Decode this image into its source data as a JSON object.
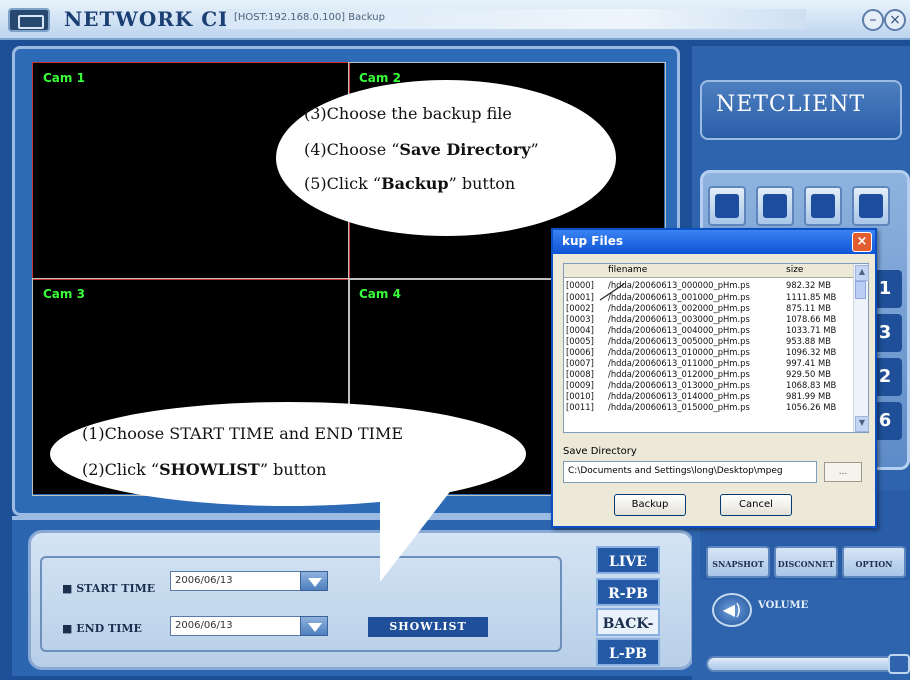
{
  "window": {
    "app_title": "NETWORK CLIENT",
    "host_info": "[HOST:192.168.0.100] Backup"
  },
  "cameras": [
    {
      "label": "Cam 1"
    },
    {
      "label": "Cam 2"
    },
    {
      "label": "Cam 3"
    },
    {
      "label": "Cam 4"
    }
  ],
  "controls": {
    "start_time_label": "START TIME",
    "start_time_value": "2006/06/13",
    "end_time_label": "END TIME",
    "end_time_value": "2006/06/13",
    "showlist_label": "SHOWLIST",
    "mode_buttons": [
      {
        "label": "LIVE"
      },
      {
        "label": "R-PB"
      },
      {
        "label": "BACK-UP"
      },
      {
        "label": "L-PB"
      }
    ]
  },
  "right_panel": {
    "brand": "NETCLIENT",
    "channel_numbers": [
      "1",
      "3",
      "2",
      "6"
    ],
    "func_buttons": [
      {
        "label": "SNAPSHOT"
      },
      {
        "label": "DISCONNET"
      },
      {
        "label": "OPTION"
      }
    ],
    "volume_label": "VOLUME"
  },
  "dialog": {
    "title": "kup Files",
    "columns": {
      "filename": "filename",
      "size": "size"
    },
    "files": [
      {
        "index": "[0000]",
        "filename": "/hdda/20060613_000000_pHm.ps",
        "size": "982.32 MB"
      },
      {
        "index": "[0001]",
        "filename": "/hdda/20060613_001000_pHm.ps",
        "size": "1111.85 MB"
      },
      {
        "index": "[0002]",
        "filename": "/hdda/20060613_002000_pHm.ps",
        "size": "875.11 MB"
      },
      {
        "index": "[0003]",
        "filename": "/hdda/20060613_003000_pHm.ps",
        "size": "1078.66 MB"
      },
      {
        "index": "[0004]",
        "filename": "/hdda/20060613_004000_pHm.ps",
        "size": "1033.71 MB"
      },
      {
        "index": "[0005]",
        "filename": "/hdda/20060613_005000_pHm.ps",
        "size": "953.88 MB"
      },
      {
        "index": "[0006]",
        "filename": "/hdda/20060613_010000_pHm.ps",
        "size": "1096.32 MB"
      },
      {
        "index": "[0007]",
        "filename": "/hdda/20060613_011000_pHm.ps",
        "size": "997.41 MB"
      },
      {
        "index": "[0008]",
        "filename": "/hdda/20060613_012000_pHm.ps",
        "size": "929.50 MB"
      },
      {
        "index": "[0009]",
        "filename": "/hdda/20060613_013000_pHm.ps",
        "size": "1068.83 MB"
      },
      {
        "index": "[0010]",
        "filename": "/hdda/20060613_014000_pHm.ps",
        "size": "981.99 MB"
      },
      {
        "index": "[0011]",
        "filename": "/hdda/20060613_015000_pHm.ps",
        "size": "1056.26 MB"
      }
    ],
    "save_dir_label": "Save Directory",
    "save_dir_value": "C:\\Documents and Settings\\long\\Desktop\\mpeg",
    "browse_label": "...",
    "backup_label": "Backup",
    "cancel_label": "Cancel"
  },
  "callouts": {
    "top": [
      {
        "pre": "(3)Choose the backup file",
        "bold": "",
        "post": ""
      },
      {
        "pre": "(4)Choose “",
        "bold": "Save Directory",
        "post": "”"
      },
      {
        "pre": "(5)Click “",
        "bold": "Backup",
        "post": "” button"
      }
    ],
    "bottom": [
      {
        "pre": "(1)Choose START TIME and END TIME",
        "bold": "",
        "post": ""
      },
      {
        "pre": "(2)Click “",
        "bold": "SHOWLIST",
        "post": "” button"
      }
    ]
  },
  "colors": {
    "camera_label": "#39ff39",
    "active_cell_border": "#cc3333",
    "dialog_titlebar": "#0d54d6"
  }
}
